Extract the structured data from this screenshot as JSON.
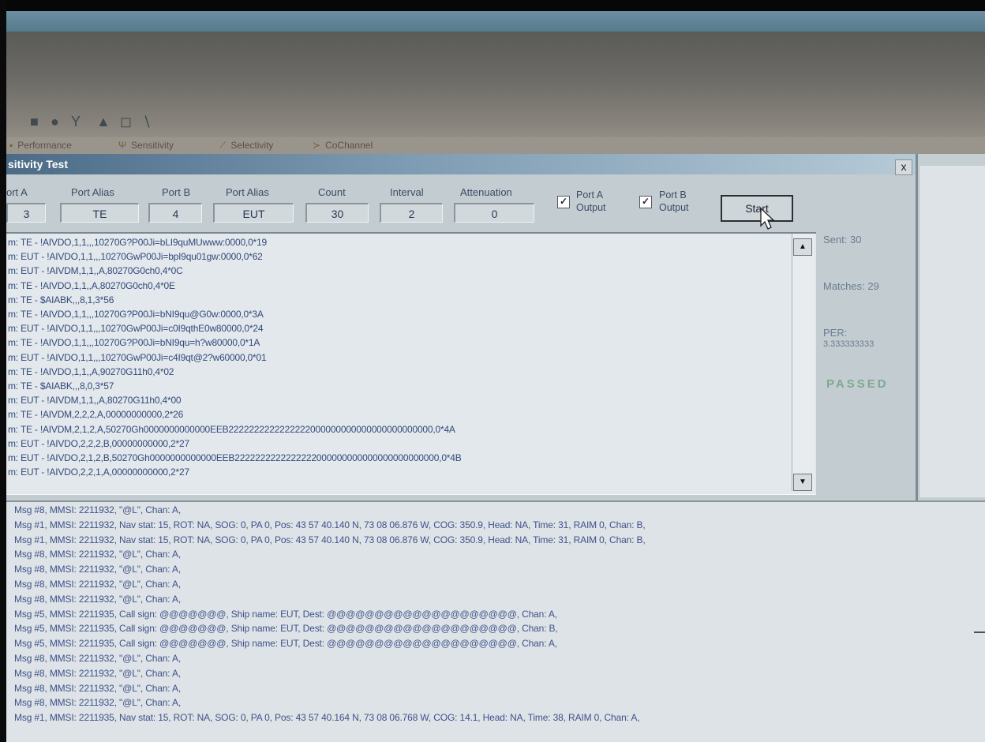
{
  "dialog": {
    "title": "sitivity Test",
    "close_label": "x",
    "fields": [
      {
        "label": "ort A",
        "value": "3"
      },
      {
        "label": "Port Alias",
        "value": "TE"
      },
      {
        "label": "Port B",
        "value": "4"
      },
      {
        "label": "Port Alias",
        "value": "EUT"
      },
      {
        "label": "Count",
        "value": "30"
      },
      {
        "label": "Interval",
        "value": "2"
      },
      {
        "label": "Attenuation",
        "value": "0"
      }
    ],
    "port_a_output": {
      "checked": true,
      "label_line1": "Port A",
      "label_line2": "Output",
      "mark": "✓"
    },
    "port_b_output": {
      "checked": true,
      "label_line1": "Port B",
      "label_line2": "Output",
      "mark": "✓"
    },
    "start_label": "Start",
    "stats": {
      "sent": "Sent: 30",
      "matches": "Matches: 29",
      "per_label": "PER:",
      "per_value": "3.333333333",
      "result": "PASSED"
    },
    "log_lines": [
      "m: TE - !AIVDO,1,1,,,10270G?P00Ji=bLI9quMUwww:0000,0*19",
      "m: EUT - !AIVDO,1,1,,,10270GwP00Ji=bpI9qu01gw:0000,0*62",
      "m: EUT - !AIVDM,1,1,,A,80270G0ch0,4*0C",
      "m: TE - !AIVDO,1,1,,A,80270G0ch0,4*0E",
      "m: TE - $AIABK,,,8,1,3*56",
      "m: TE - !AIVDO,1,1,,,10270G?P00Ji=bNI9qu@G0w:0000,0*3A",
      "m: EUT - !AIVDO,1,1,,,10270GwP00Ji=c0I9qthE0w80000,0*24",
      "m: TE - !AIVDO,1,1,,,10270G?P00Ji=bNI9qu=h?w80000,0*1A",
      "m: EUT - !AIVDO,1,1,,,10270GwP00Ji=c4I9qt@2?w60000,0*01",
      "m: TE - !AIVDO,1,1,,A,90270G11h0,4*02",
      "m: TE - $AIABK,,,8,0,3*57",
      "m: EUT - !AIVDM,1,1,,A,80270G11h0,4*00",
      "m: TE - !AIVDM,2,2,2,A,00000000000,2*26",
      "m: TE - !AIVDM,2,1,2,A,50270Gh0000000000000EEB2222222222222222000000000000000000000000,0*4A",
      "m: EUT - !AIVDO,2,2,2,B,00000000000,2*27",
      "m: EUT - !AIVDO,2,1,2,B,50270Gh0000000000000EEB2222222222222222000000000000000000000000,0*4B",
      "m: EUT - !AIVDO,2,2,1,A,00000000000,2*27"
    ]
  },
  "app": {
    "tabs": [
      {
        "label": "Performance"
      },
      {
        "label": "Sensitivity"
      },
      {
        "label": "Selectivity"
      },
      {
        "label": "CoChannel"
      }
    ]
  },
  "messages": [
    "Msg #8, MMSI: 2211932, \"@L\", Chan: A,",
    "Msg #1, MMSI: 2211932, Nav stat: 15, ROT: NA, SOG: 0, PA 0, Pos: 43 57 40.140 N, 73 08 06.876 W, COG: 350.9, Head: NA, Time: 31, RAIM 0, Chan: B,",
    "Msg #1, MMSI: 2211932, Nav stat: 15, ROT: NA, SOG: 0, PA 0, Pos: 43 57 40.140 N, 73 08 06.876 W, COG: 350.9, Head: NA, Time: 31, RAIM 0, Chan: B,",
    "Msg #8, MMSI: 2211932, \"@L\", Chan: A,",
    "Msg #8, MMSI: 2211932, \"@L\", Chan: A,",
    "Msg #8, MMSI: 2211932, \"@L\", Chan: A,",
    "Msg #8, MMSI: 2211932, \"@L\", Chan: A,",
    "Msg #5, MMSI: 2211935, Call sign: @@@@@@@, Ship name: EUT, Dest: @@@@@@@@@@@@@@@@@@@@, Chan: A,",
    "Msg #5, MMSI: 2211935, Call sign: @@@@@@@, Ship name: EUT, Dest: @@@@@@@@@@@@@@@@@@@@, Chan: B,",
    "Msg #5, MMSI: 2211935, Call sign: @@@@@@@, Ship name: EUT, Dest: @@@@@@@@@@@@@@@@@@@@, Chan: A,",
    "Msg #8, MMSI: 2211932, \"@L\", Chan: A,",
    "Msg #8, MMSI: 2211932, \"@L\", Chan: A,",
    "Msg #8, MMSI: 2211932, \"@L\", Chan: A,",
    "Msg #8, MMSI: 2211932, \"@L\", Chan: A,",
    "Msg #1, MMSI: 2211935, Nav stat: 15, ROT: NA, SOG: 0, PA 0, Pos: 43 57 40.164 N, 73 08 06.768 W, COG: 14.1, Head: NA, Time: 38, RAIM 0, Chan: A,"
  ]
}
